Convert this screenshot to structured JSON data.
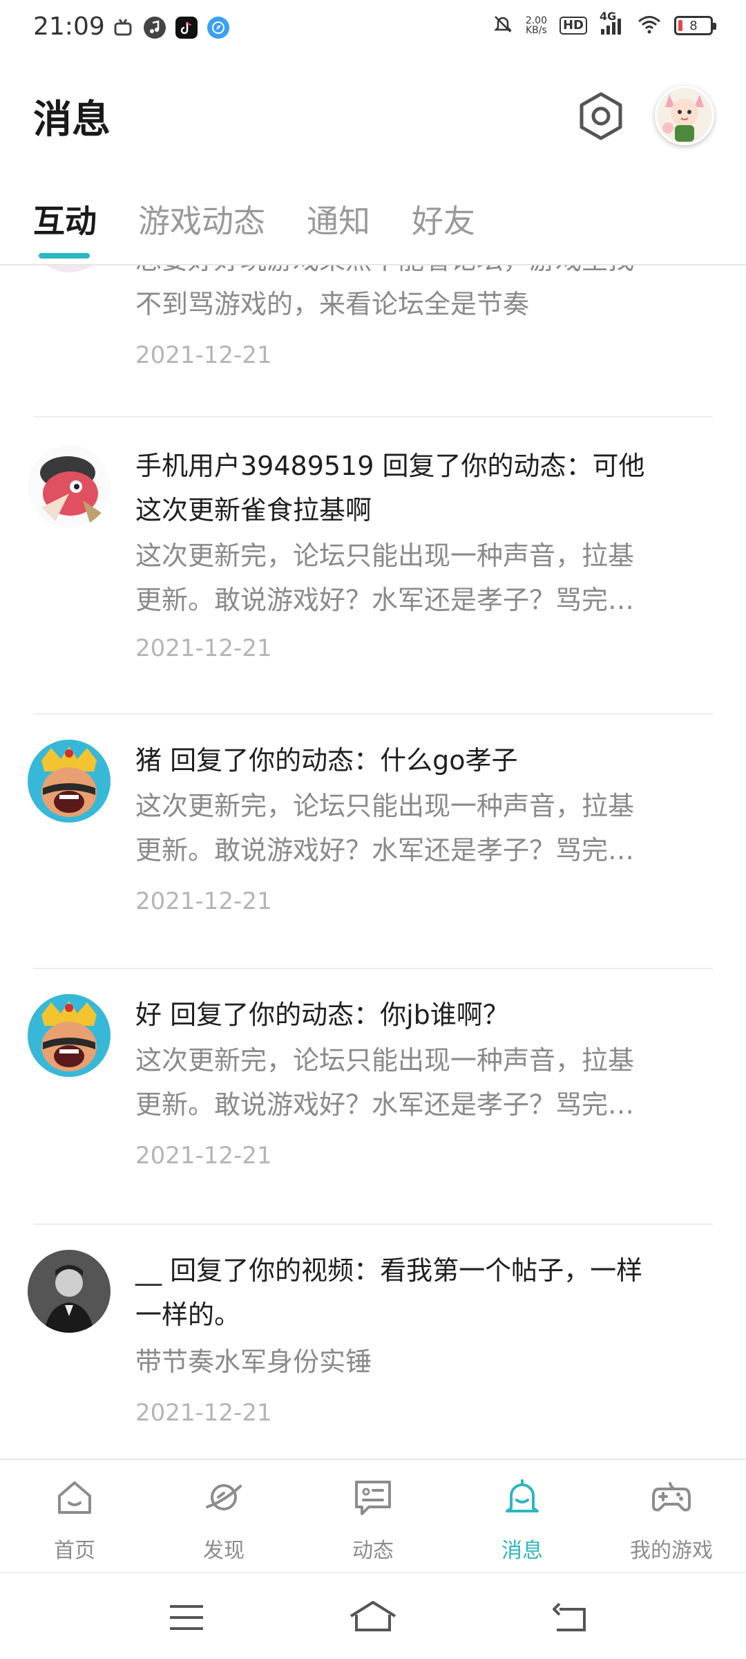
{
  "status_bar": {
    "time": "21:09",
    "speed_value": "2.00",
    "speed_unit": "KB/s",
    "hd_badge": "HD",
    "network_badge": "4G",
    "battery_level": "8",
    "battery_color": "#e64545"
  },
  "header": {
    "title": "消息"
  },
  "tabs": [
    {
      "label": "互动",
      "active": true
    },
    {
      "label": "游戏动态",
      "active": false
    },
    {
      "label": "通知",
      "active": false
    },
    {
      "label": "好友",
      "active": false
    }
  ],
  "messages": [
    {
      "title": "",
      "desc_line1": "总要好好玩游戏果然不能看论坛，游戏里找",
      "desc_line2": "不到骂游戏的，来看论坛全是节奏",
      "date": "2021-12-21"
    },
    {
      "title_line1": "手机用户39489519  回复了你的动态：可他",
      "title_line2": "这次更新雀食拉基啊",
      "desc_line1": "这次更新完，论坛只能出现一种声音，拉基",
      "desc_line2": "更新。敢说游戏好？水军还是孝子？骂完…",
      "date": "2021-12-21"
    },
    {
      "title_line1": "猪  回复了你的动态：什么go孝子",
      "desc_line1": "这次更新完，论坛只能出现一种声音，拉基",
      "desc_line2": "更新。敢说游戏好？水军还是孝子？骂完…",
      "date": "2021-12-21"
    },
    {
      "title_line1": "好  回复了你的动态：你jb谁啊？",
      "desc_line1": "这次更新完，论坛只能出现一种声音，拉基",
      "desc_line2": "更新。敢说游戏好？水军还是孝子？骂完…",
      "date": "2021-12-21"
    },
    {
      "title_line1": "__  回复了你的视频：看我第一个帖子，一样",
      "title_line2": "一样的。",
      "desc_line1": "带节奏水军身份实锤",
      "date": "2021-12-21"
    }
  ],
  "bottom_nav": [
    {
      "label": "首页",
      "icon": "home-icon",
      "active": false
    },
    {
      "label": "发现",
      "icon": "planet-icon",
      "active": false
    },
    {
      "label": "动态",
      "icon": "chat-card-icon",
      "active": false
    },
    {
      "label": "消息",
      "icon": "bell-icon",
      "active": true
    },
    {
      "label": "我的游戏",
      "icon": "gamepad-icon",
      "active": false
    }
  ],
  "colors": {
    "accent": "#2bb7bf",
    "inactive": "#8c8c8c"
  }
}
